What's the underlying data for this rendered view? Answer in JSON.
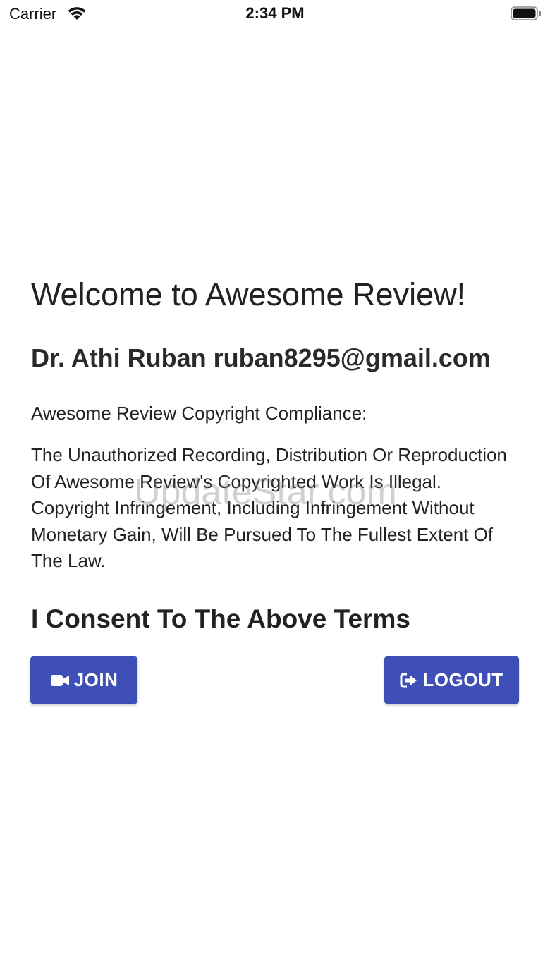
{
  "status_bar": {
    "carrier": "Carrier",
    "time": "2:34 PM",
    "wifi_icon": "wifi-icon",
    "battery_icon": "battery-icon"
  },
  "main": {
    "welcome": "Welcome to Awesome Review!",
    "user_line": "Dr. Athi Ruban ruban8295@gmail.com",
    "compliance_heading": "Awesome Review Copyright Compliance:",
    "notice": "The Unauthorized Recording, Distribution Or Reproduction Of Awesome Review's Copyrighted Work Is Illegal. Copyright Infringement, Including Infringement Without Monetary Gain, Will Be Pursued To The Fullest Extent Of The Law.",
    "consent": "I Consent To The Above Terms"
  },
  "buttons": {
    "join_label": "JOIN",
    "join_icon": "video-camera-icon",
    "logout_label": "LOGOUT",
    "logout_icon": "sign-out-icon",
    "color": "#3f4fb8"
  },
  "watermark": "UpdateStar.com"
}
